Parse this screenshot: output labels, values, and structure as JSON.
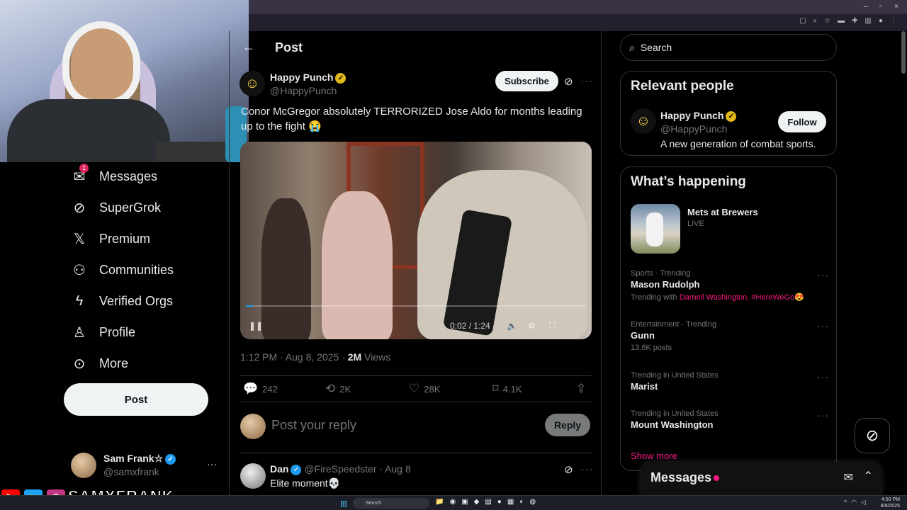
{
  "window": {
    "minimize": "–",
    "maximize": "▫",
    "close": "×"
  },
  "sidebar": {
    "items": [
      {
        "label": "Messages",
        "icon": "mail-icon",
        "badge": "1"
      },
      {
        "label": "SuperGrok",
        "icon": "grok-icon"
      },
      {
        "label": "Premium",
        "icon": "x-logo-icon"
      },
      {
        "label": "Communities",
        "icon": "people-icon"
      },
      {
        "label": "Verified Orgs",
        "icon": "lightning-icon"
      },
      {
        "label": "Profile",
        "icon": "person-icon"
      },
      {
        "label": "More",
        "icon": "more-circle-icon"
      }
    ],
    "post_label": "Post",
    "account": {
      "name": "Sam Frank☆",
      "handle": "@samxfrank",
      "more": "···"
    }
  },
  "overlay": {
    "name": "SAMXFRANK"
  },
  "main": {
    "back": "←",
    "title": "Post",
    "author": {
      "name": "Happy Punch",
      "handle": "@HappyPunch"
    },
    "subscribe_label": "Subscribe",
    "text": "Conor McGregor absolutely TERRORIZED Jose Aldo for months leading up to the fight 😭",
    "video": {
      "time": "0:02 / 1:24"
    },
    "meta": {
      "time": "1:12 PM · Aug 8, 2025 · ",
      "views": "2M",
      "views_label": " Views"
    },
    "actions": {
      "replies": "242",
      "reposts": "2K",
      "likes": "28K",
      "bookmarks": "4.1K"
    },
    "reply_placeholder": "Post your reply",
    "reply_label": "Reply",
    "comment": {
      "name": "Dan",
      "handle": "@FireSpeedster · Aug 8",
      "text": "Elite moment💀"
    }
  },
  "right": {
    "search_placeholder": "Search",
    "relevant": {
      "title": "Relevant people",
      "name": "Happy Punch",
      "handle": "@HappyPunch",
      "bio": "A new generation of combat sports.",
      "follow_label": "Follow"
    },
    "happening": {
      "title": "What’s happening",
      "featured": {
        "title": "Mets at Brewers",
        "status": "LIVE"
      },
      "trends": [
        {
          "category": "Sports · Trending",
          "name": "Mason Rudolph",
          "sub_prefix": "Trending with ",
          "sub_links": "Darnell Washington, #HereWeGo😍"
        },
        {
          "category": "Entertainment · Trending",
          "name": "Gunn",
          "sub_prefix": "13.6K posts",
          "sub_links": ""
        },
        {
          "category": "Trending in United States",
          "name": "Marist",
          "sub_prefix": "",
          "sub_links": ""
        },
        {
          "category": "Trending in United States",
          "name": "Mount Washington",
          "sub_prefix": "",
          "sub_links": ""
        }
      ],
      "show_more": "Show more"
    },
    "messages_drawer": "Messages"
  },
  "taskbar": {
    "search": "Search",
    "time": "4:50 PM",
    "date": "8/9/2025"
  }
}
